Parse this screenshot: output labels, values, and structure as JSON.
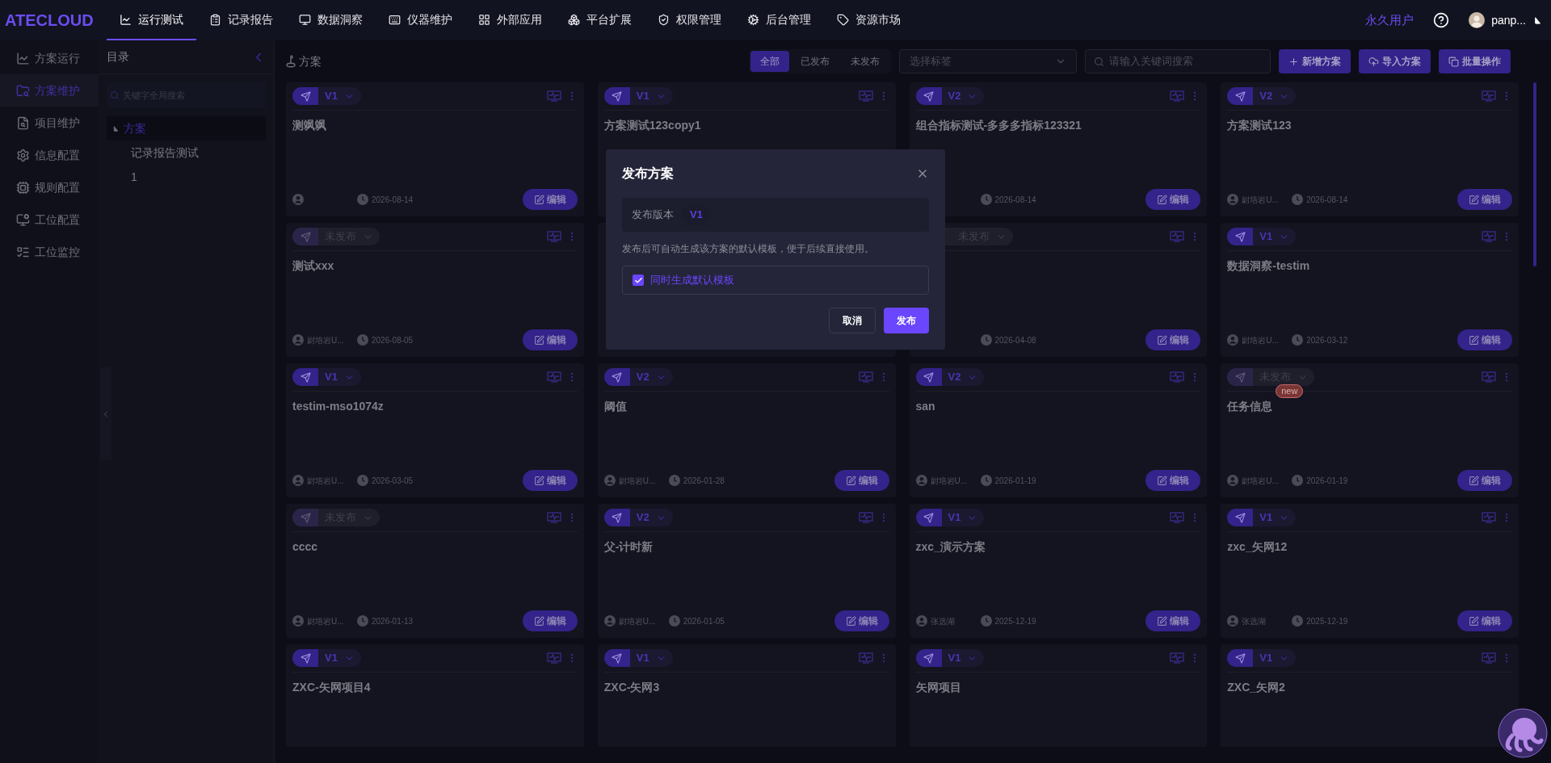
{
  "nav": {
    "logo": "ATECLOUD",
    "items": [
      {
        "label": "运行测试",
        "selected": true
      },
      {
        "label": "记录报告",
        "selected": false
      },
      {
        "label": "数据洞察",
        "selected": false
      },
      {
        "label": "仪器维护",
        "selected": false
      },
      {
        "label": "外部应用",
        "selected": false
      },
      {
        "label": "平台扩展",
        "selected": false
      },
      {
        "label": "权限管理",
        "selected": false
      },
      {
        "label": "后台管理",
        "selected": false
      },
      {
        "label": "资源市场",
        "selected": false
      }
    ],
    "account_type": "永久用户",
    "user": "panp..."
  },
  "sidebar": {
    "items": [
      {
        "label": "方案运行",
        "selected": false
      },
      {
        "label": "方案维护",
        "selected": true
      },
      {
        "label": "项目维护",
        "selected": false
      },
      {
        "label": "信息配置",
        "selected": false
      },
      {
        "label": "规则配置",
        "selected": false
      },
      {
        "label": "工位配置",
        "selected": false
      },
      {
        "label": "工位监控",
        "selected": false
      }
    ]
  },
  "directory": {
    "title": "目录",
    "search_placeholder": "关键字全局搜索",
    "tree": [
      {
        "label": "方案",
        "expanded": true,
        "selected": true,
        "children": [
          {
            "label": "记录报告测试"
          },
          {
            "label": "1"
          }
        ]
      }
    ]
  },
  "toolbar": {
    "breadcrumb": "方案",
    "filters": [
      {
        "label": "全部",
        "selected": true
      },
      {
        "label": "已发布",
        "selected": false
      },
      {
        "label": "未发布",
        "selected": false
      }
    ],
    "tag_placeholder": "选择标签",
    "search_placeholder": "请输入关键词搜索",
    "actions": [
      "新增方案",
      "导入方案",
      "批量操作"
    ]
  },
  "cards": [
    {
      "kind": "full",
      "title": "测飒飒",
      "status": {
        "kind": "version",
        "label": "V1"
      },
      "date": "2026-08-14",
      "edit": "编辑"
    },
    {
      "kind": "top",
      "title": "方案测试123copy1",
      "status": {
        "kind": "version",
        "label": "V1"
      }
    },
    {
      "kind": "right",
      "title": "组合指标测试-多多多指标123321",
      "status": {
        "kind": "version",
        "label": "V2"
      },
      "date": "2026-08-14",
      "edit": "编辑"
    },
    {
      "kind": "full",
      "title": "方案测试123",
      "status": {
        "kind": "version",
        "label": "V2"
      },
      "author": "尉培岩U...",
      "date": "2026-08-14",
      "edit": "编辑"
    },
    {
      "kind": "full",
      "title": "测试xxx",
      "status": {
        "kind": "unpublished",
        "label": "未发布"
      },
      "author": "尉培岩U...",
      "date": "2026-08-05",
      "edit": "编辑"
    },
    {
      "kind": "covered"
    },
    {
      "kind": "edge",
      "status": {
        "kind": "unpublished",
        "label": "未发布"
      },
      "date": "2026-04-08",
      "edit": "编辑"
    },
    {
      "kind": "full",
      "title": "数据洞察-testim",
      "status": {
        "kind": "version",
        "label": "V1"
      },
      "author": "尉培岩U...",
      "date": "2026-03-12",
      "edit": "编辑"
    },
    {
      "kind": "full",
      "title": "testim-mso1074z",
      "status": {
        "kind": "version",
        "label": "V1"
      },
      "author": "尉培岩U...",
      "date": "2026-03-05",
      "edit": "编辑"
    },
    {
      "kind": "full",
      "title": "阈值",
      "status": {
        "kind": "version",
        "label": "V2"
      },
      "author": "尉培岩U...",
      "date": "2026-01-28",
      "edit": "编辑"
    },
    {
      "kind": "full",
      "title": "san",
      "status": {
        "kind": "version",
        "label": "V2"
      },
      "author": "尉培岩U...",
      "date": "2026-01-19",
      "edit": "编辑"
    },
    {
      "kind": "full",
      "title": "任务信息",
      "status": {
        "kind": "unpublished",
        "label": "未发布"
      },
      "badge": "new",
      "author": "尉培岩U...",
      "date": "2026-01-19",
      "edit": "编辑"
    },
    {
      "kind": "full",
      "title": "cccc",
      "status": {
        "kind": "unpublished",
        "label": "未发布"
      },
      "author": "尉培岩U...",
      "date": "2026-01-13",
      "edit": "编辑"
    },
    {
      "kind": "full",
      "title": "父-计时新",
      "status": {
        "kind": "version",
        "label": "V2"
      },
      "author": "尉培岩U...",
      "date": "2026-01-05",
      "edit": "编辑"
    },
    {
      "kind": "full",
      "title": "zxc_演示方案",
      "status": {
        "kind": "version",
        "label": "V1"
      },
      "author": "张选湖",
      "date": "2025-12-19",
      "edit": "编辑"
    },
    {
      "kind": "full",
      "title": "zxc_矢网12",
      "status": {
        "kind": "version",
        "label": "V1"
      },
      "author": "张选湖",
      "date": "2025-12-19",
      "edit": "编辑"
    },
    {
      "kind": "top",
      "title": "ZXC-矢网项目4",
      "status": {
        "kind": "version",
        "label": "V1"
      }
    },
    {
      "kind": "top",
      "title": "ZXC-矢网3",
      "status": {
        "kind": "version",
        "label": "V1"
      }
    },
    {
      "kind": "top",
      "title": "矢网项目",
      "status": {
        "kind": "version",
        "label": "V1"
      }
    },
    {
      "kind": "top",
      "title": "ZXC_矢网2",
      "status": {
        "kind": "version",
        "label": "V1"
      }
    }
  ],
  "modal": {
    "title": "发布方案",
    "version_label": "发布版本",
    "version": "V1",
    "description": "发布后可自动生成该方案的默认模板，便于后续直接使用。",
    "checkbox": {
      "label": "同时生成默认模板",
      "checked": true
    },
    "buttons": [
      {
        "label": "取消",
        "kind": "secondary"
      },
      {
        "label": "发布",
        "kind": "primary"
      }
    ]
  }
}
